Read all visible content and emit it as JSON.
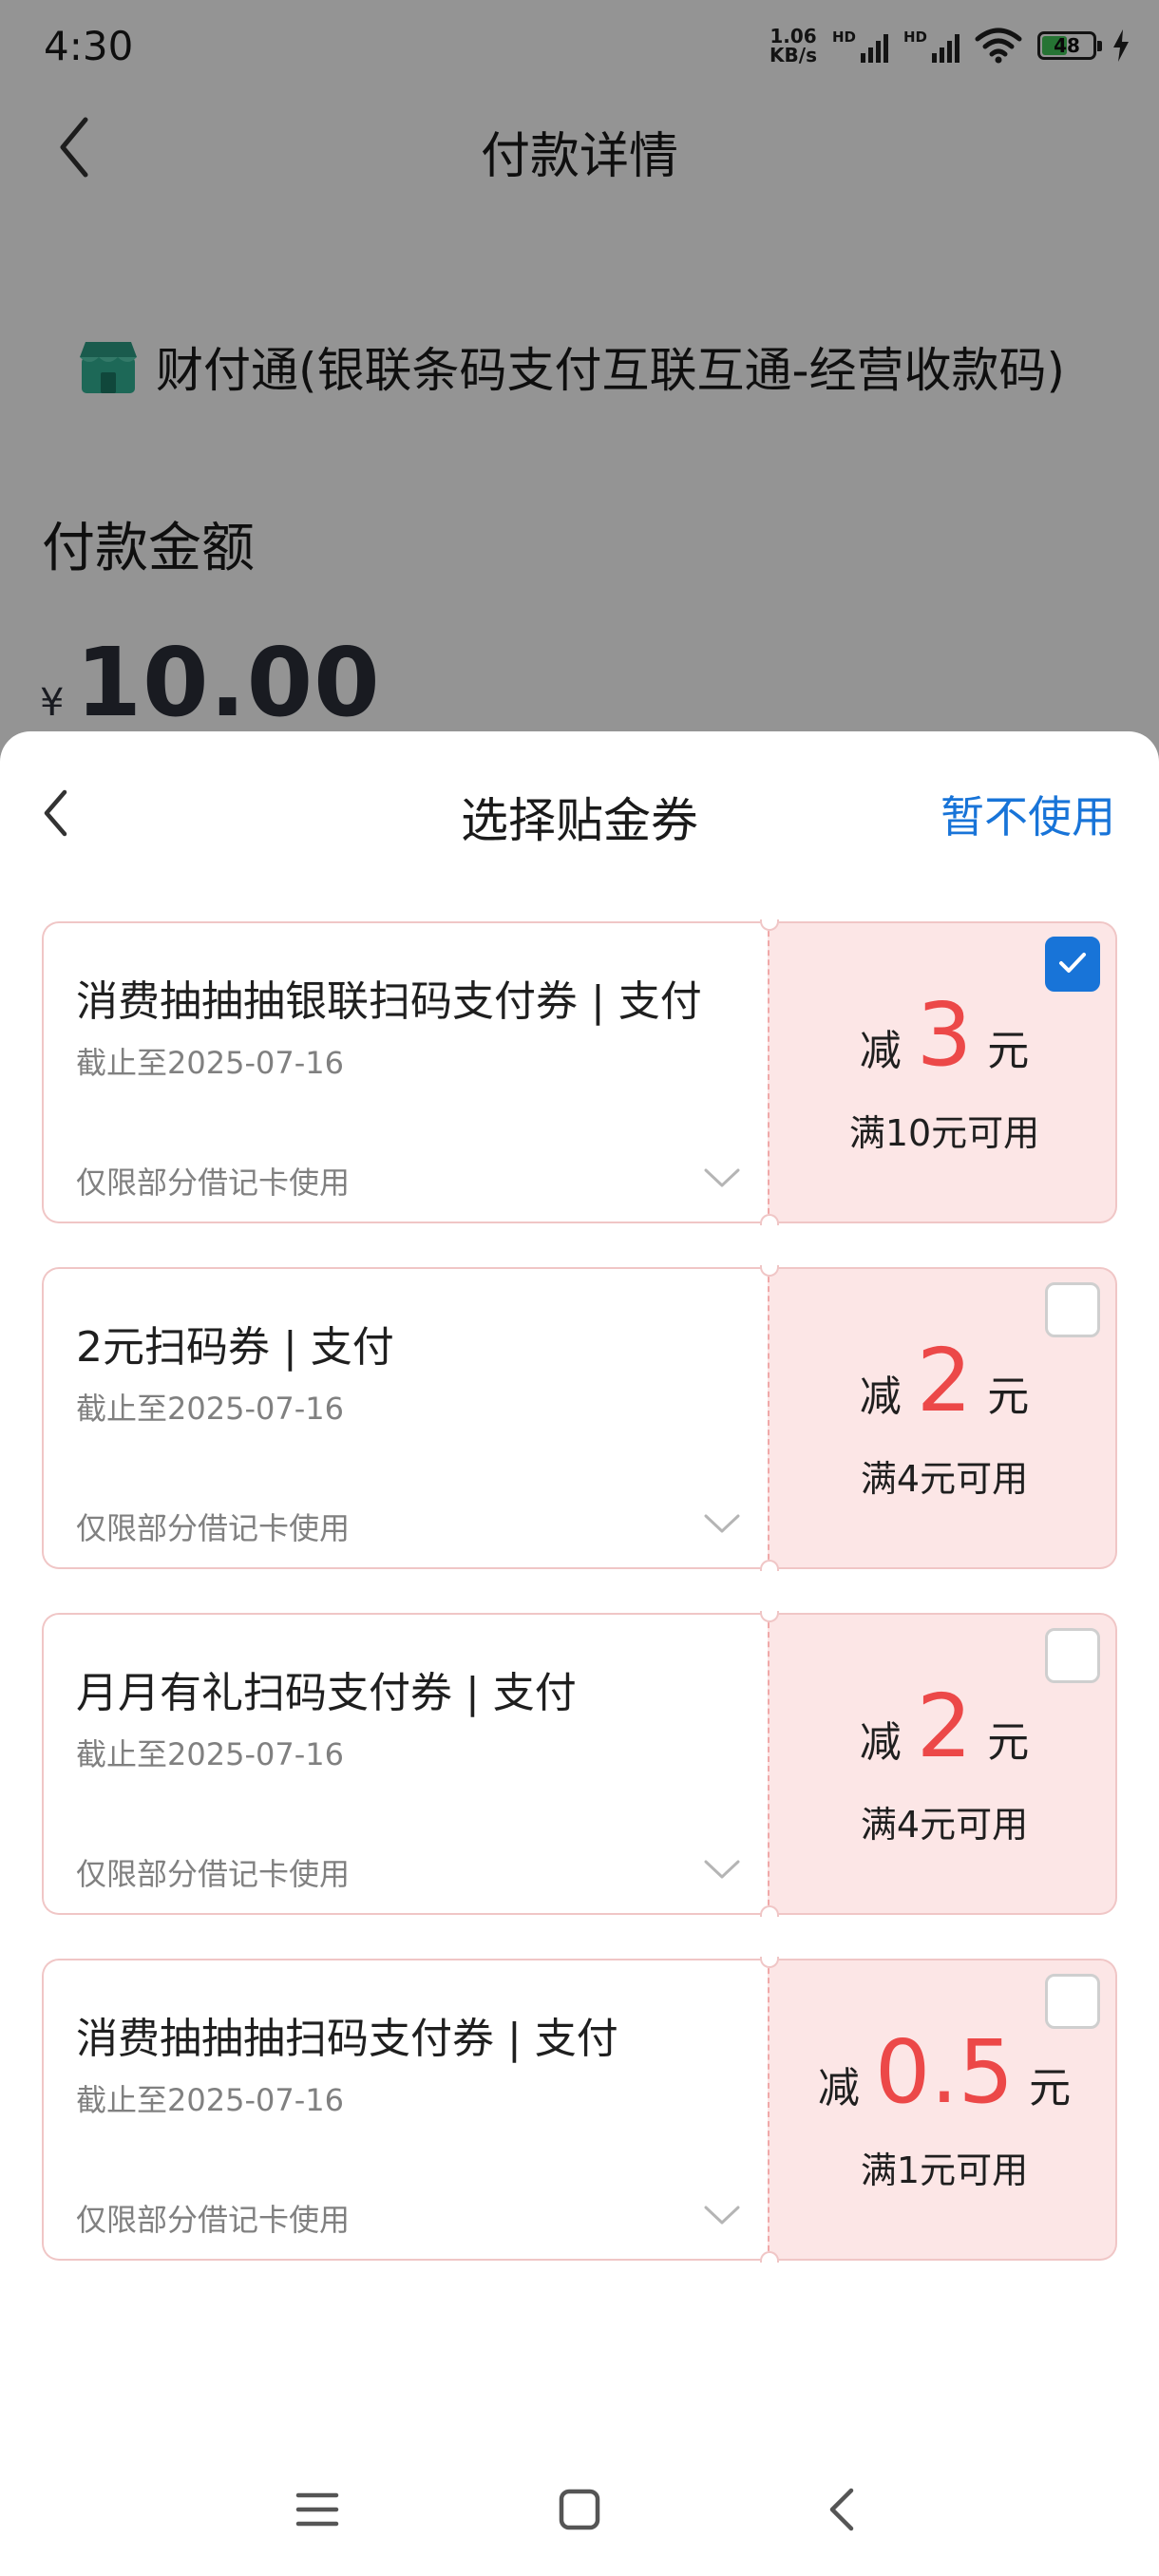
{
  "status_bar": {
    "time": "4:30",
    "net_speed_value": "1.06",
    "net_speed_unit": "KB/s",
    "signal1_label": "HD",
    "signal2_label": "HD",
    "battery_level": "48"
  },
  "background_page": {
    "title": "付款详情",
    "merchant_name": "财付通(银联条码支付互联互通-经营收款码)",
    "amount_label": "付款金额",
    "currency_symbol": "¥",
    "amount_value": "10.00"
  },
  "sheet": {
    "title": "选择贴金券",
    "skip_label": "暂不使用",
    "coupons": [
      {
        "name": "消费抽抽抽银联扫码支付券 | 支付",
        "expiry": "截止至2025-07-16",
        "limit": "仅限部分借记卡使用",
        "prefix": "减",
        "discount": "3",
        "unit": "元",
        "condition": "满10元可用",
        "selected": true
      },
      {
        "name": "2元扫码券 | 支付",
        "expiry": "截止至2025-07-16",
        "limit": "仅限部分借记卡使用",
        "prefix": "减",
        "discount": "2",
        "unit": "元",
        "condition": "满4元可用",
        "selected": false
      },
      {
        "name": "月月有礼扫码支付券 | 支付",
        "expiry": "截止至2025-07-16",
        "limit": "仅限部分借记卡使用",
        "prefix": "减",
        "discount": "2",
        "unit": "元",
        "condition": "满4元可用",
        "selected": false
      },
      {
        "name": "消费抽抽抽扫码支付券 | 支付",
        "expiry": "截止至2025-07-16",
        "limit": "仅限部分借记卡使用",
        "prefix": "减",
        "discount": "0.5",
        "unit": "元",
        "condition": "满1元可用",
        "selected": false
      }
    ]
  },
  "colors": {
    "accent_blue": "#1874d8",
    "discount_red": "#ec4848",
    "coupon_bg": "#fce6e6"
  },
  "icons": {
    "back": "chevron-left-icon",
    "expand": "chevron-down-icon",
    "check": "checkmark-icon",
    "shop": "shop-icon",
    "menu": "menu-icon",
    "home": "home-square-icon",
    "nav_back": "back-triangle-icon"
  }
}
